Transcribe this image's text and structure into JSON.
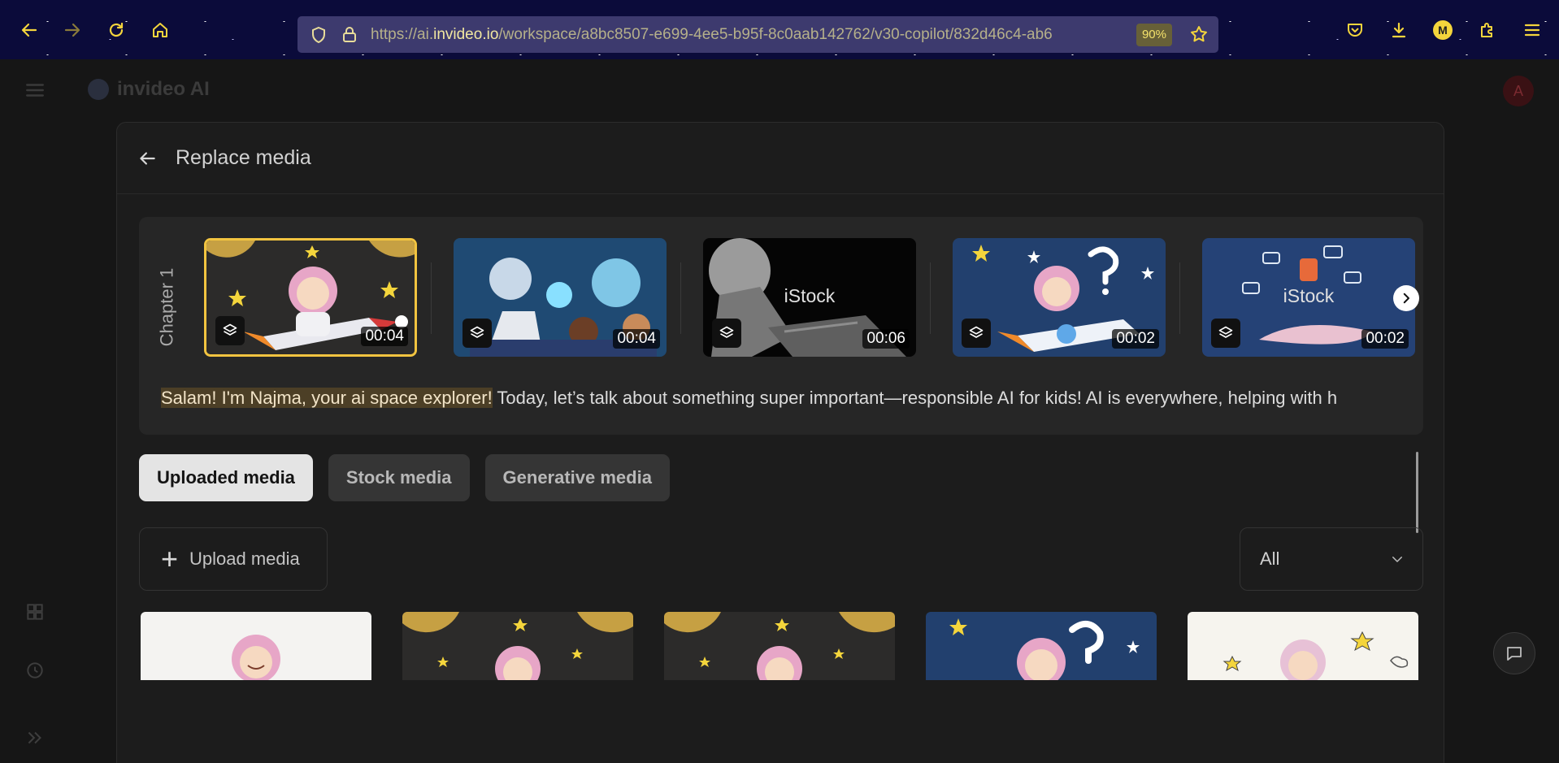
{
  "browser": {
    "url_prefix": "https://ai.",
    "url_domain": "invideo.io",
    "url_path": "/workspace/a8bc8507-e699-4ee5-b95f-8c0aab142762/v30-copilot/832d46c4-ab6",
    "zoom": "90%",
    "profile_initial": "M"
  },
  "app": {
    "brand": "invideo AI",
    "user_initial": "A"
  },
  "modal": {
    "title": "Replace media",
    "chapter_label": "Chapter 1",
    "clips": [
      {
        "duration": "00:04",
        "selected": true,
        "watermark": ""
      },
      {
        "duration": "00:04",
        "selected": false,
        "watermark": ""
      },
      {
        "duration": "00:06",
        "selected": false,
        "watermark": "iStock"
      },
      {
        "duration": "00:02",
        "selected": false,
        "watermark": ""
      },
      {
        "duration": "00:02",
        "selected": false,
        "watermark": "iStock"
      }
    ],
    "script_highlight": "Salam! I'm Najma, your ai space explorer!",
    "script_rest": " Today, let’s talk about something super important—responsible AI for kids! AI is everywhere, helping with h",
    "tabs": [
      {
        "label": "Uploaded media",
        "active": true
      },
      {
        "label": "Stock media",
        "active": false
      },
      {
        "label": "Generative media",
        "active": false
      }
    ],
    "upload_label": "Upload media",
    "filter_value": "All"
  },
  "colors": {
    "accent_selected": "#f2c440",
    "toolbar_bg": "#0b0b3a",
    "url_domain": "#f1e7a0"
  }
}
